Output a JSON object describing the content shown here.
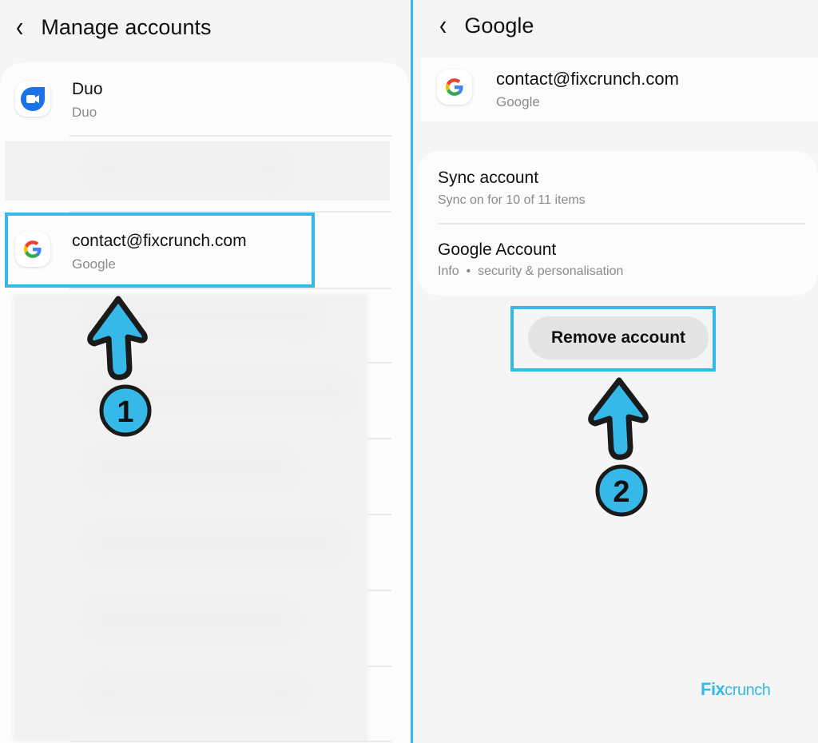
{
  "left_screen": {
    "header": {
      "back_icon": "‹",
      "title": "Manage accounts"
    },
    "accounts": [
      {
        "name": "Duo",
        "type": "Duo",
        "icon": "duo-video-icon"
      },
      {
        "name": "contact@fixcrunch.com",
        "type": "Google",
        "icon": "google-g-icon"
      }
    ],
    "step_marker": "1"
  },
  "right_screen": {
    "header": {
      "back_icon": "‹",
      "title": "Google"
    },
    "account": {
      "email": "contact@fixcrunch.com",
      "type": "Google",
      "icon": "google-g-icon"
    },
    "options": [
      {
        "title": "Sync account",
        "subtitle": "Sync on for 10 of 11 items"
      },
      {
        "title": "Google Account",
        "subtitle": "Info  •  security & personalisation"
      }
    ],
    "remove_button": "Remove account",
    "step_marker": "2"
  },
  "watermark": {
    "brand_prefix": "Fix",
    "brand_suffix": "crunch"
  },
  "colors": {
    "highlight": "#36b9e8",
    "duo_blue": "#1a73e8"
  }
}
